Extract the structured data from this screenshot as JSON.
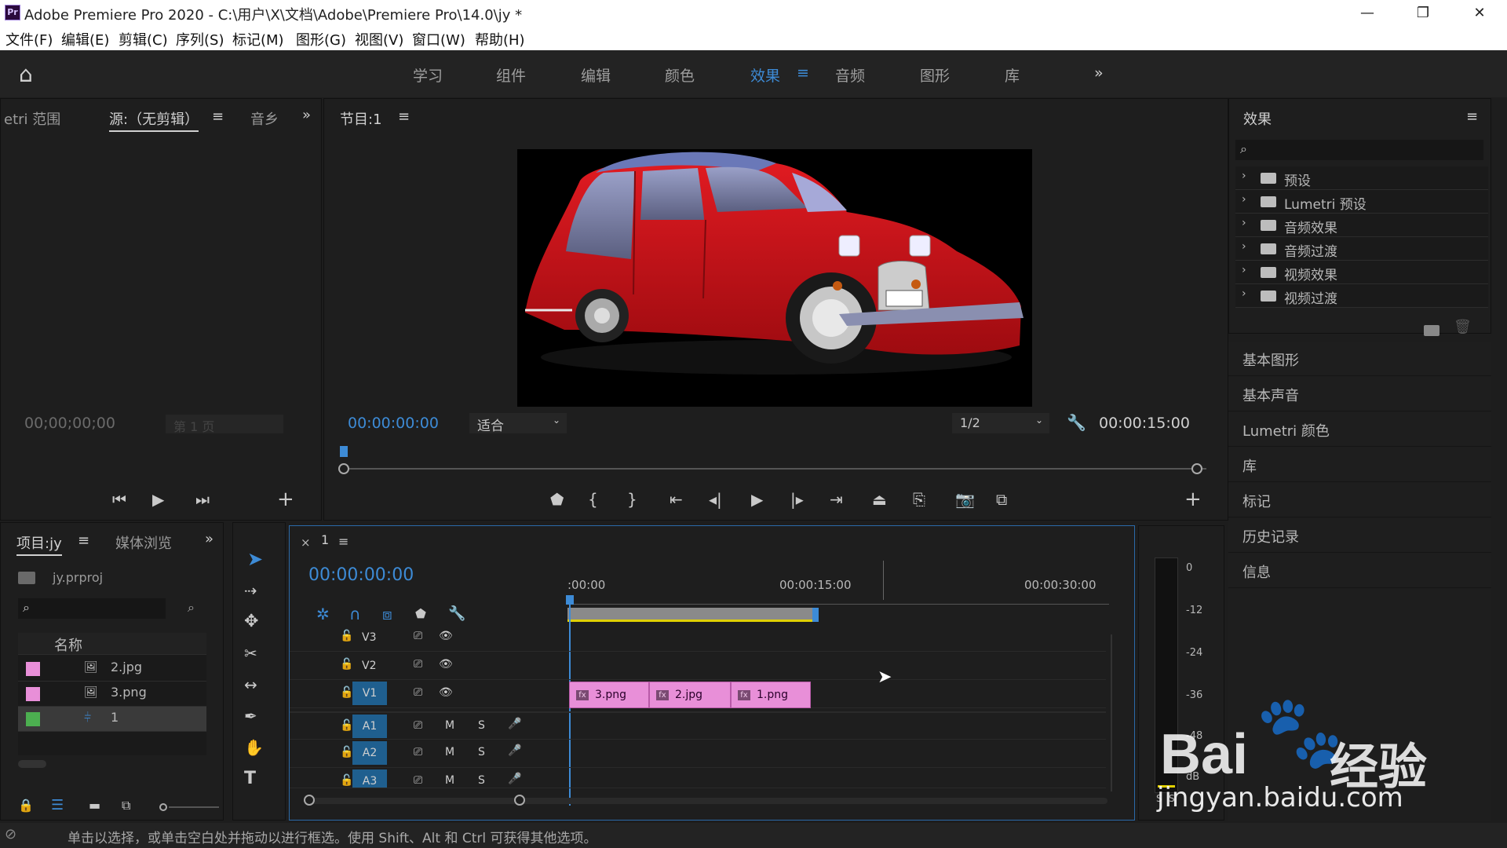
{
  "window": {
    "title": "Adobe Premiere Pro 2020 - C:\\用户\\X\\文档\\Adobe\\Premiere Pro\\14.0\\jy *",
    "icon_label": "Pr",
    "minimize": "—",
    "restore": "❐",
    "close": "✕"
  },
  "menu": [
    "文件(F)",
    "编辑(E)",
    "剪辑(C)",
    "序列(S)",
    "标记(M)",
    "图形(G)",
    "视图(V)",
    "窗口(W)",
    "帮助(H)"
  ],
  "workspaces": {
    "home": "⌂",
    "items": [
      "学习",
      "组件",
      "编辑",
      "颜色",
      "效果",
      "音频",
      "图形",
      "库"
    ],
    "active": "效果",
    "more": "»",
    "menu_icon": "≡"
  },
  "source_panel": {
    "tab_left": "etri 范围",
    "tab_source": "源:（无剪辑）",
    "tab_audio": "音乡",
    "tab_menu": "≡",
    "more": "»",
    "timecode": "00;00;00;00",
    "page": "第 1 页"
  },
  "program_panel": {
    "title": "节目:1",
    "menu": "≡",
    "timecode": "00:00:00:00",
    "zoom": "适合",
    "resolution": "1/2",
    "duration": "00:00:15:00",
    "playhead_fraction": 0
  },
  "project_panel": {
    "tab_project": "项目:jy",
    "menu": "≡",
    "tab_media": "媒体浏览",
    "more": "»",
    "project_file": "jy.prproj",
    "search_placeholder": "",
    "column_name": "名称",
    "items": [
      {
        "name": "2.jpg",
        "color": "#e88fd8"
      },
      {
        "name": "3.png",
        "color": "#e88fd8"
      },
      {
        "name": "1",
        "color": "#4caf50"
      }
    ]
  },
  "timeline": {
    "tab_close": "×",
    "sequence": "1",
    "menu": "≡",
    "timecode": "00:00:00:00",
    "ruler": [
      ":00:00",
      "00:00:15:00",
      "00:00:30:00"
    ],
    "tracks": [
      {
        "label": "V3",
        "type": "video"
      },
      {
        "label": "V2",
        "type": "video"
      },
      {
        "label": "V1",
        "type": "video"
      },
      {
        "label": "A1",
        "type": "audio"
      },
      {
        "label": "A2",
        "type": "audio"
      },
      {
        "label": "A3",
        "type": "audio"
      }
    ],
    "clips": [
      {
        "name": "3.png",
        "fx": "fx"
      },
      {
        "name": "2.jpg",
        "fx": "fx"
      },
      {
        "name": "1.png",
        "fx": "fx"
      }
    ],
    "toggles": {
      "mute": "M",
      "solo": "S"
    }
  },
  "meter": {
    "labels": [
      "0",
      "-12",
      "-24",
      "-36",
      "-48",
      "dB"
    ],
    "solo_labels": [
      "S",
      "S"
    ]
  },
  "effects_panel": {
    "title": "效果",
    "menu": "≡",
    "search_placeholder": "",
    "folders": [
      "预设",
      "Lumetri 预设",
      "音频效果",
      "音频过渡",
      "视频效果",
      "视频过渡"
    ]
  },
  "side_sections": [
    "基本图形",
    "基本声音",
    "Lumetri 颜色",
    "库",
    "标记",
    "历史记录",
    "信息"
  ],
  "status_bar": "单击以选择，或单击空白处并拖动以进行框选。使用 Shift、Alt 和 Ctrl 可获得其他选项。",
  "watermark": {
    "text1": "Bai",
    "text2": "经验",
    "url": "jingyan.baidu.com"
  },
  "colors": {
    "accent": "#3d8bd6",
    "clip": "#e88fd8",
    "track_active": "#1f5f8f",
    "car": "#d4141a"
  }
}
